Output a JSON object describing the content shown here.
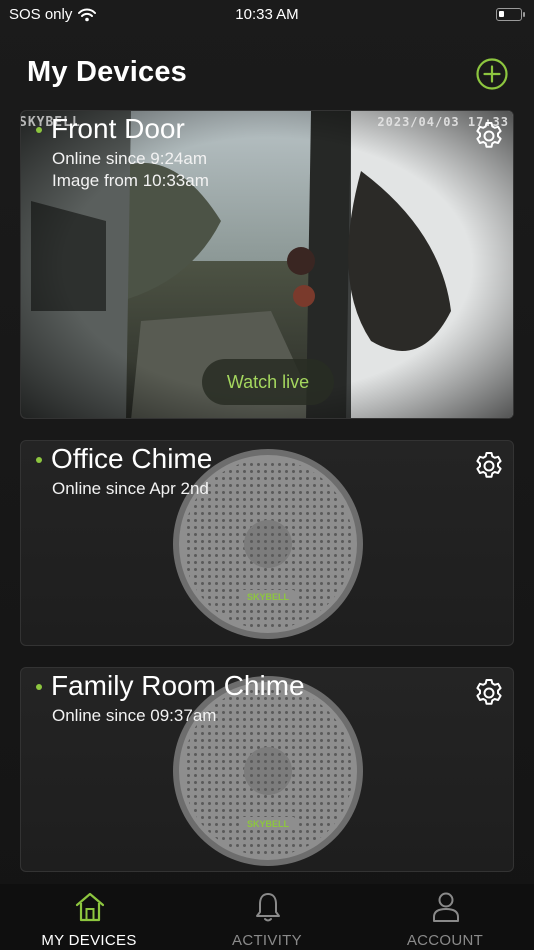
{
  "status_bar": {
    "carrier": "SOS only",
    "time": "10:33 AM"
  },
  "header": {
    "title": "My Devices",
    "add_icon": "plus-circle-icon"
  },
  "accent_color": "#8dc63f",
  "devices": [
    {
      "name": "Front Door",
      "status": "Online since 9:24am",
      "image_note": "Image from 10:33am",
      "camera_timestamp": "2023/04/03 17:33",
      "camera_brand": "SKYBELL",
      "watch_live_label": "Watch live"
    },
    {
      "name": "Office Chime",
      "status": "Online since Apr 2nd",
      "chime_brand": "SKYBELL"
    },
    {
      "name": "Family Room Chime",
      "status": "Online since 09:37am",
      "chime_brand": "SKYBELL"
    }
  ],
  "tabs": [
    {
      "label": "MY DEVICES",
      "icon": "home-icon",
      "active": true
    },
    {
      "label": "ACTIVITY",
      "icon": "bell-icon",
      "active": false
    },
    {
      "label": "ACCOUNT",
      "icon": "person-icon",
      "active": false
    }
  ]
}
